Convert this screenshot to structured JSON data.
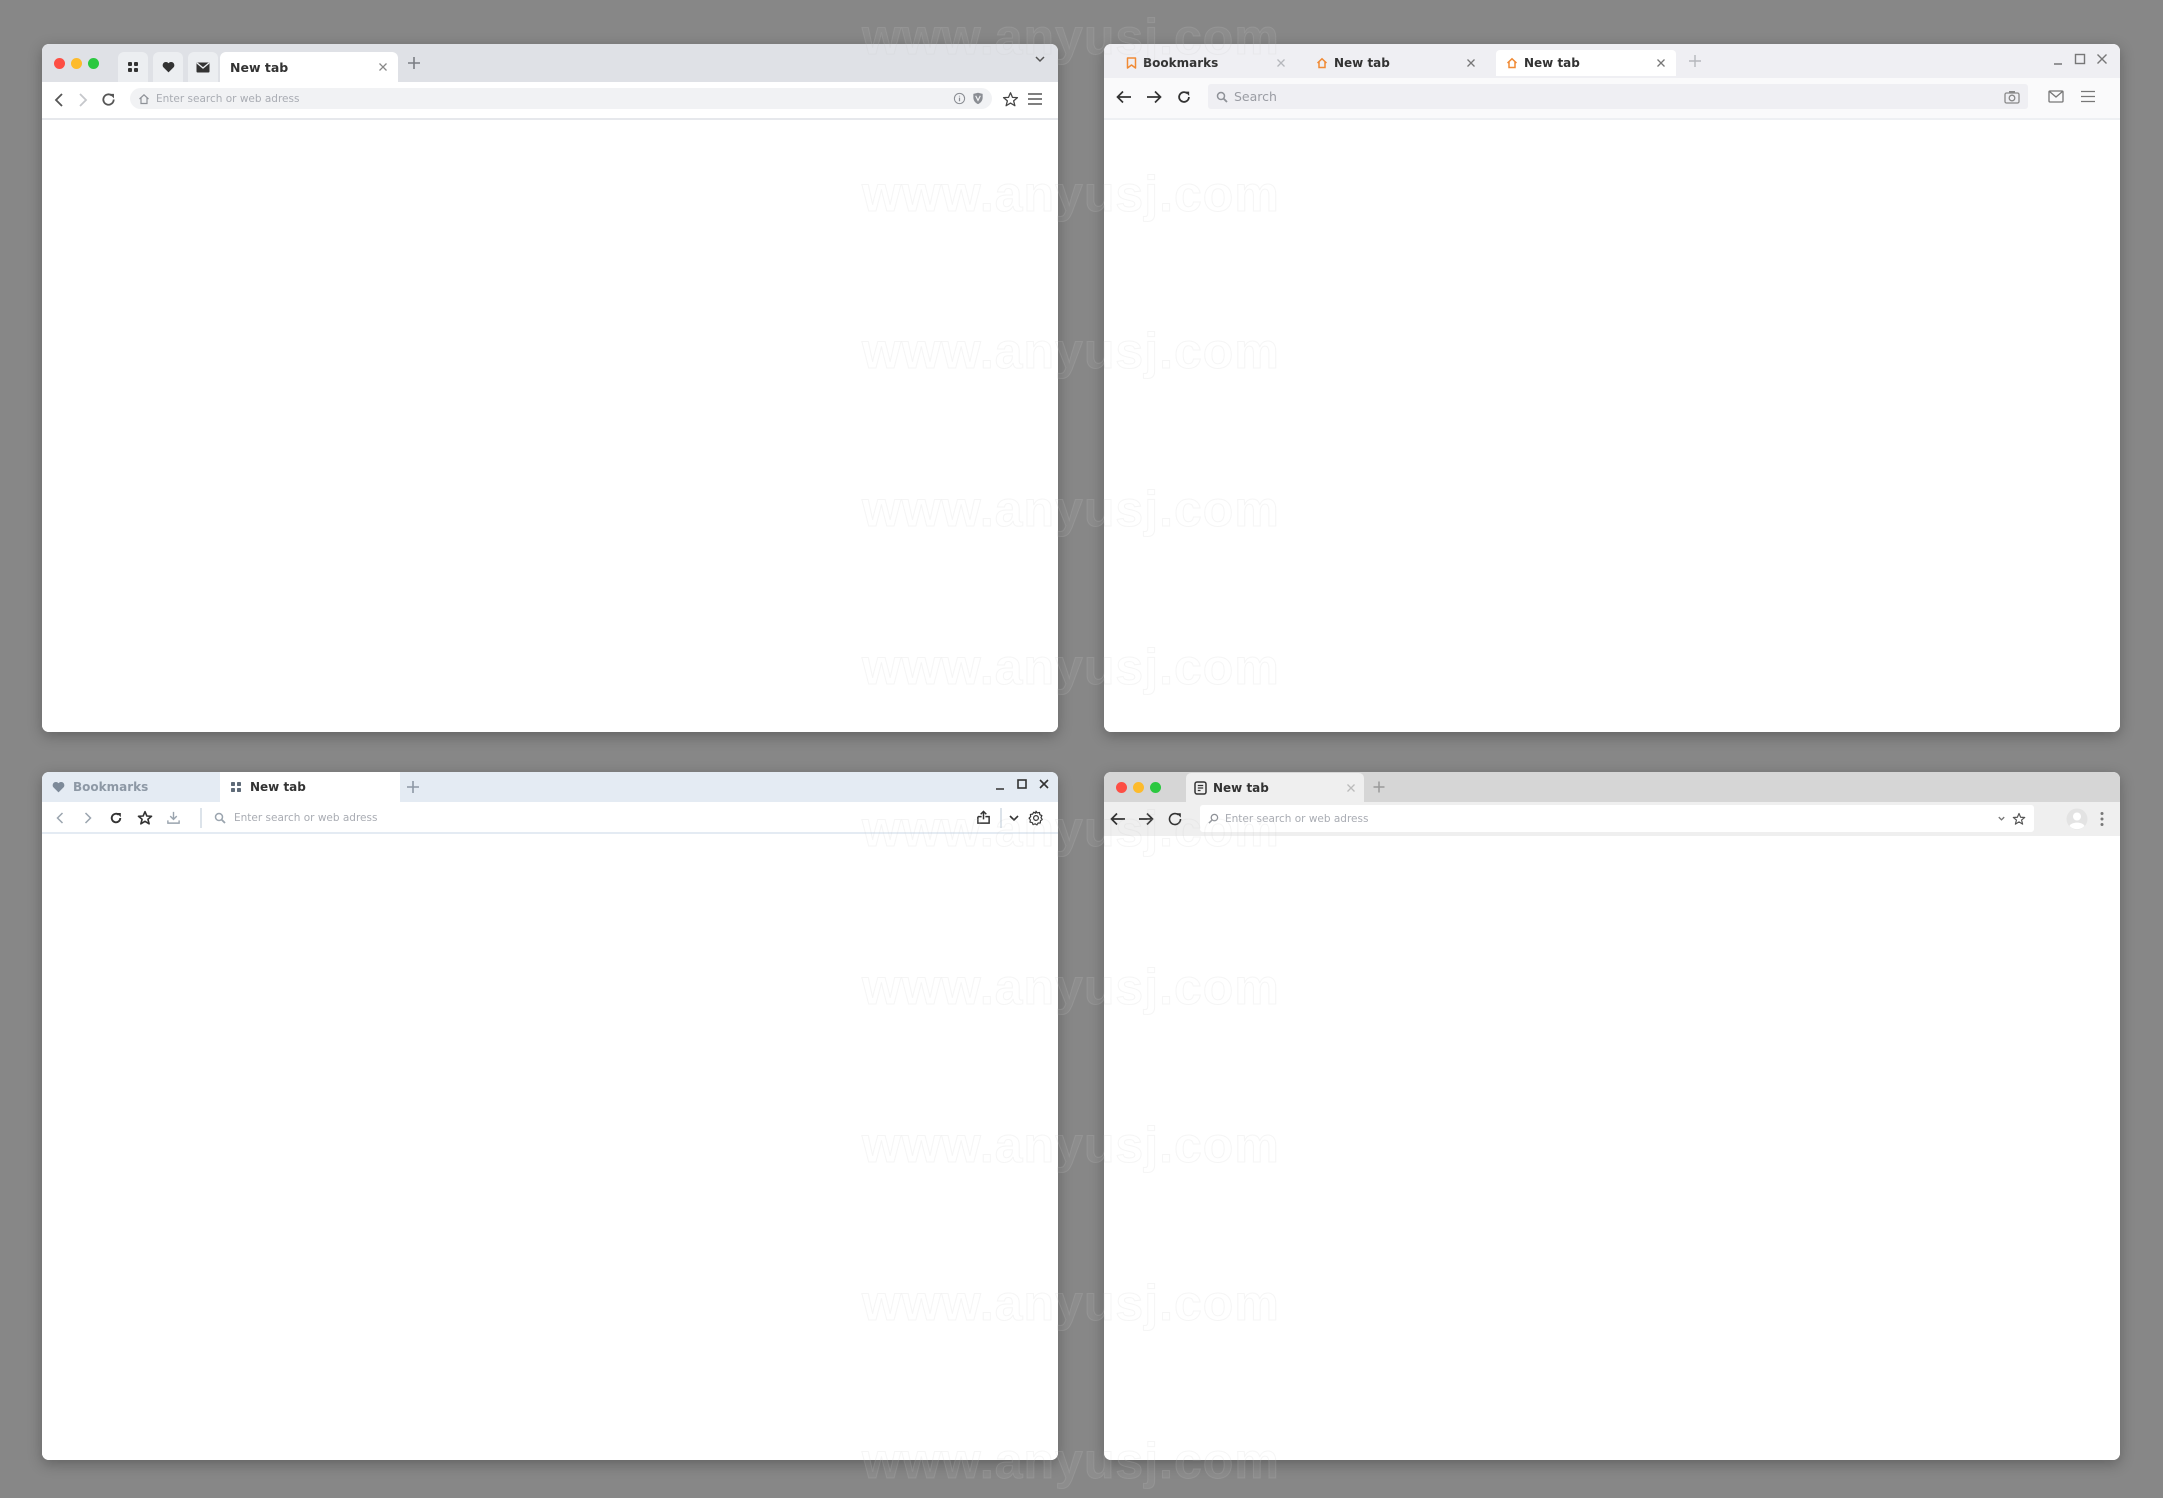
{
  "watermark": "www.anyusj.com",
  "colors": {
    "background": "#878787",
    "traffic_red": "#fd4e44",
    "traffic_yellow": "#fdbb2c",
    "traffic_green": "#2bc840",
    "accent_orange": "#f08a35"
  },
  "window1": {
    "pinned_tabs": [
      {
        "icon": "grid-icon"
      },
      {
        "icon": "heart-icon"
      },
      {
        "icon": "mail-icon"
      }
    ],
    "active_tab": {
      "label": "New tab",
      "close": "×"
    },
    "new_tab": "+",
    "address_bar": {
      "placeholder": "Enter search or web adress",
      "icon": "home-icon"
    },
    "address_icons": [
      "info-icon",
      "shield-icon"
    ],
    "toolbar_icons": [
      "back-icon",
      "forward-icon",
      "reload-icon",
      "star-icon",
      "menu-icon"
    ],
    "tab_overflow": "chevron-down-icon"
  },
  "window2": {
    "tabs": [
      {
        "label": "Bookmarks",
        "icon": "bookmark-icon",
        "close": "×",
        "active": false
      },
      {
        "label": "New tab",
        "icon": "home-icon",
        "close": "×",
        "active": false
      },
      {
        "label": "New tab",
        "icon": "home-icon",
        "close": "×",
        "active": true
      }
    ],
    "new_tab": "+",
    "window_controls": [
      "minimize-icon",
      "maximize-icon",
      "close-icon"
    ],
    "address_bar": {
      "placeholder": "Search",
      "icon": "search-icon"
    },
    "toolbar_icons": [
      "back-icon",
      "forward-icon",
      "reload-icon",
      "camera-icon",
      "mail-icon",
      "menu-icon"
    ]
  },
  "window3": {
    "tabs": [
      {
        "label": "Bookmarks",
        "icon": "heart-icon",
        "active": false
      },
      {
        "label": "New tab",
        "icon": "grid-icon",
        "active": true
      }
    ],
    "new_tab": "+",
    "window_controls": [
      "minimize-icon",
      "maximize-icon",
      "close-icon"
    ],
    "address_bar": {
      "placeholder": "Enter search or web adress",
      "icon": "search-icon"
    },
    "toolbar_icons": [
      "back-icon",
      "forward-icon",
      "reload-icon",
      "star-icon",
      "download-icon",
      "share-icon",
      "chevron-down-icon",
      "gear-icon"
    ]
  },
  "window4": {
    "active_tab": {
      "label": "New tab",
      "icon": "document-icon",
      "close": "×"
    },
    "new_tab": "+",
    "address_bar": {
      "placeholder": "Enter search or web adress",
      "icon": "search-icon"
    },
    "toolbar_icons": [
      "back-icon",
      "forward-icon",
      "reload-icon",
      "chevron-down-icon",
      "star-icon",
      "avatar-icon",
      "more-vertical-icon"
    ]
  }
}
